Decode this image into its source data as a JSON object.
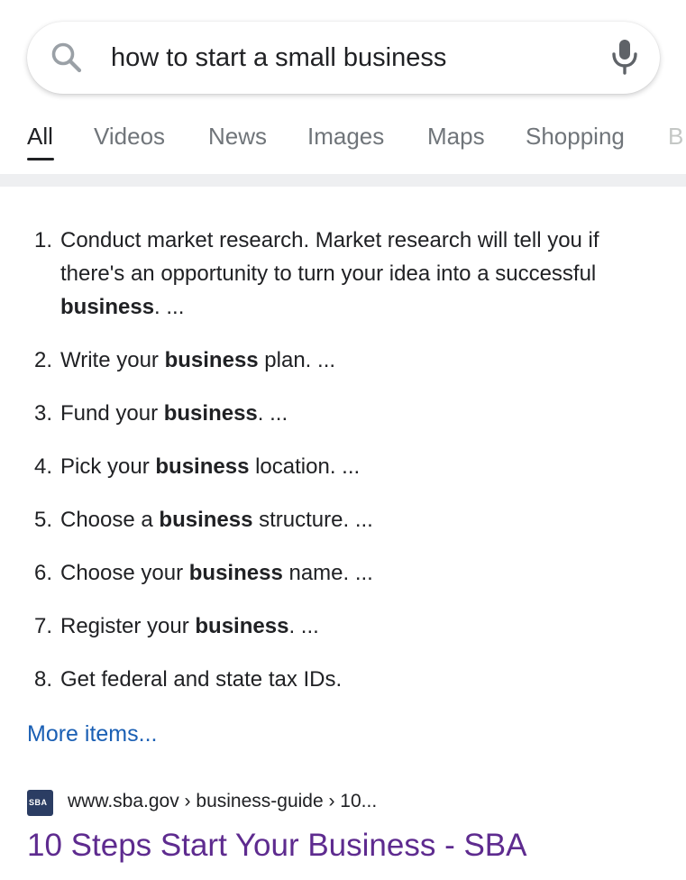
{
  "search": {
    "query": "how to start a small business"
  },
  "tabs": [
    {
      "label": "All",
      "active": true
    },
    {
      "label": "Videos",
      "active": false
    },
    {
      "label": "News",
      "active": false
    },
    {
      "label": "Images",
      "active": false
    },
    {
      "label": "Maps",
      "active": false
    },
    {
      "label": "Shopping",
      "active": false
    },
    {
      "label": "B",
      "active": false
    }
  ],
  "steps": [
    {
      "number": "1.",
      "parts": [
        {
          "text": "Conduct market research. Market research will tell you if there's an opportunity to turn your idea into a successful ",
          "bold": false
        },
        {
          "text": "business",
          "bold": true
        },
        {
          "text": ". ...",
          "bold": false
        }
      ]
    },
    {
      "number": "2.",
      "parts": [
        {
          "text": "Write your ",
          "bold": false
        },
        {
          "text": "business",
          "bold": true
        },
        {
          "text": " plan. ...",
          "bold": false
        }
      ]
    },
    {
      "number": "3.",
      "parts": [
        {
          "text": "Fund your ",
          "bold": false
        },
        {
          "text": "business",
          "bold": true
        },
        {
          "text": ". ...",
          "bold": false
        }
      ]
    },
    {
      "number": "4.",
      "parts": [
        {
          "text": "Pick your ",
          "bold": false
        },
        {
          "text": "business",
          "bold": true
        },
        {
          "text": " location. ...",
          "bold": false
        }
      ]
    },
    {
      "number": "5.",
      "parts": [
        {
          "text": "Choose a ",
          "bold": false
        },
        {
          "text": "business",
          "bold": true
        },
        {
          "text": " structure. ...",
          "bold": false
        }
      ]
    },
    {
      "number": "6.",
      "parts": [
        {
          "text": "Choose your ",
          "bold": false
        },
        {
          "text": "business",
          "bold": true
        },
        {
          "text": " name. ...",
          "bold": false
        }
      ]
    },
    {
      "number": "7.",
      "parts": [
        {
          "text": "Register your ",
          "bold": false
        },
        {
          "text": "business",
          "bold": true
        },
        {
          "text": ". ...",
          "bold": false
        }
      ]
    },
    {
      "number": "8.",
      "parts": [
        {
          "text": "Get federal and state tax IDs.",
          "bold": false
        }
      ]
    }
  ],
  "more_items_label": "More items...",
  "result": {
    "favicon_text": "SBA",
    "url": "www.sba.gov › business-guide › 10...",
    "title": "10 Steps Start Your Business - SBA"
  },
  "colors": {
    "link_blue": "#1a5fb4",
    "visited_purple": "#5e2b8f",
    "text": "#202124",
    "muted": "#70757a",
    "divider": "#eeeff1"
  },
  "icons": {
    "search": "search-icon",
    "mic": "mic-icon",
    "favicon": "sba-favicon-icon"
  }
}
